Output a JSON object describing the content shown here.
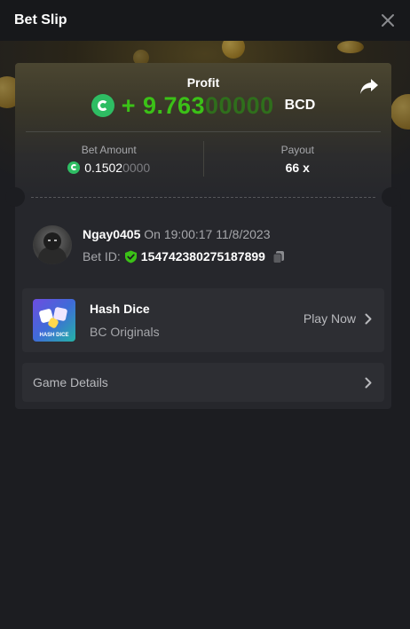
{
  "header": {
    "title": "Bet Slip"
  },
  "profit": {
    "label": "Profit",
    "amount_main": "+ 9.763",
    "amount_trailing": "00000",
    "currency": "BCD"
  },
  "stats": {
    "bet_amount_label": "Bet Amount",
    "bet_amount_main": "0.1502",
    "bet_amount_trailing": "0000",
    "payout_label": "Payout",
    "payout_value": "66 x"
  },
  "user": {
    "username": "Ngay0405",
    "timestamp": "On 19:00:17 11/8/2023",
    "bet_id_label": "Bet ID:",
    "bet_id_value": "154742380275187899"
  },
  "game": {
    "name": "Hash Dice",
    "provider": "BC Originals",
    "thumb_text": "HASH DICE",
    "play_label": "Play Now"
  },
  "details": {
    "label": "Game Details"
  },
  "colors": {
    "accent_green": "#3bc117",
    "coin_green": "#2ebd63",
    "background": "#1c1d21",
    "card": "#26272c"
  }
}
